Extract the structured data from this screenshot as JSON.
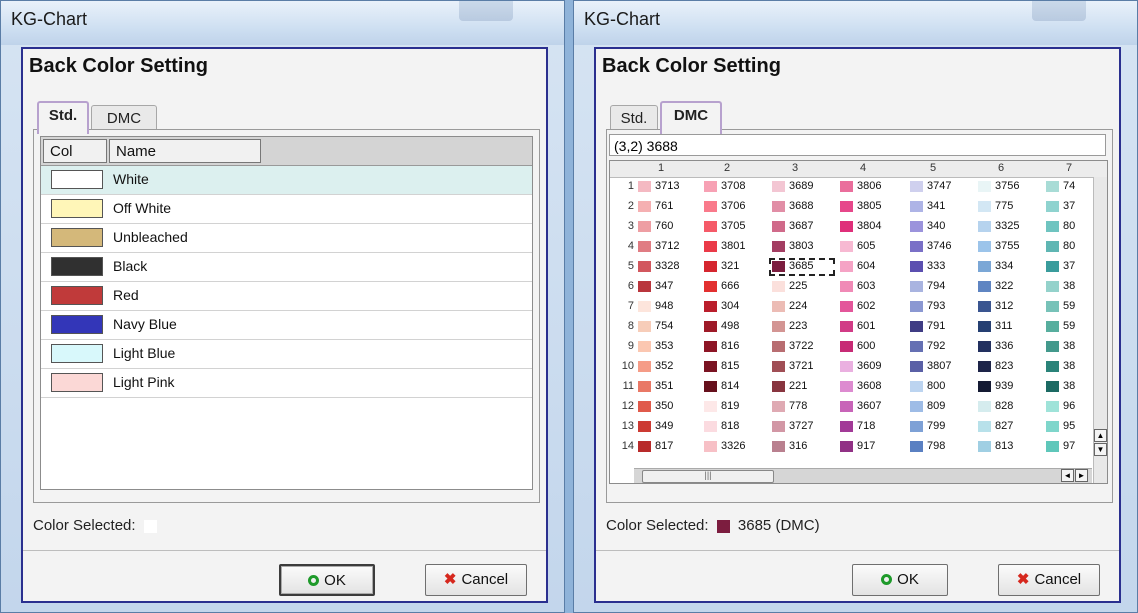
{
  "left": {
    "window_title": "KG-Chart",
    "header": "Back Color Setting",
    "tabs": [
      {
        "label": "Std.",
        "active": true
      },
      {
        "label": "DMC",
        "active": false
      }
    ],
    "columns": {
      "col": "Col",
      "name": "Name"
    },
    "rows": [
      {
        "name": "White",
        "color": "#ffffff"
      },
      {
        "name": "Off White",
        "color": "#fff6b8"
      },
      {
        "name": "Unbleached",
        "color": "#d4b87a"
      },
      {
        "name": "Black",
        "color": "#303030"
      },
      {
        "name": "Red",
        "color": "#c03a3a"
      },
      {
        "name": "Navy Blue",
        "color": "#3336b8"
      },
      {
        "name": "Light Blue",
        "color": "#d8f8fb"
      },
      {
        "name": "Light Pink",
        "color": "#fbd8d6"
      }
    ],
    "color_selected_label": "Color Selected:",
    "ok_label": "OK",
    "cancel_label": "Cancel"
  },
  "right": {
    "window_title": "KG-Chart",
    "header": "Back Color Setting",
    "tabs": [
      {
        "label": "Std.",
        "active": false
      },
      {
        "label": "DMC",
        "active": true
      }
    ],
    "address": "(3,2) 3688",
    "col_headers": [
      "1",
      "2",
      "3",
      "4",
      "5",
      "6",
      "7"
    ],
    "row_numbers": [
      "1",
      "2",
      "3",
      "4",
      "5",
      "6",
      "7",
      "8",
      "9",
      "10",
      "11",
      "12",
      "13",
      "14"
    ],
    "cells": [
      [
        [
          "3713",
          "#f4b9c2"
        ],
        [
          "3708",
          "#f7a1b4"
        ],
        [
          "3689",
          "#f3c6d3"
        ],
        [
          "3806",
          "#ea6e9c"
        ],
        [
          "3747",
          "#cfd0ee"
        ],
        [
          "3756",
          "#e9f5f6"
        ],
        [
          "74",
          "#a8dcd6"
        ]
      ],
      [
        [
          "761",
          "#f5b0b2"
        ],
        [
          "3706",
          "#f97a8b"
        ],
        [
          "3688",
          "#e18ea6"
        ],
        [
          "3805",
          "#e6478a"
        ],
        [
          "341",
          "#aeb4e6"
        ],
        [
          "775",
          "#d3e7f4"
        ],
        [
          "37",
          "#8fd3cf"
        ]
      ],
      [
        [
          "760",
          "#ee9ea3"
        ],
        [
          "3705",
          "#f55a68"
        ],
        [
          "3687",
          "#d06a8a"
        ],
        [
          "3804",
          "#df2f7a"
        ],
        [
          "340",
          "#9b93dc"
        ],
        [
          "3325",
          "#b6d3ee"
        ],
        [
          "80",
          "#6fc4c0"
        ]
      ],
      [
        [
          "3712",
          "#e07c83"
        ],
        [
          "3801",
          "#ea3a48"
        ],
        [
          "3803",
          "#a33d62"
        ],
        [
          "605",
          "#f7b9d2"
        ],
        [
          "3746",
          "#7a70c7"
        ],
        [
          "3755",
          "#9cc4ea"
        ],
        [
          "80",
          "#5fb6b3"
        ]
      ],
      [
        [
          "3328",
          "#d2575e"
        ],
        [
          "321",
          "#d5262f"
        ],
        [
          "3685",
          "#7c1d3f"
        ],
        [
          "604",
          "#f5a3c5"
        ],
        [
          "333",
          "#5b4fb0"
        ],
        [
          "334",
          "#7ba7d6"
        ],
        [
          "37",
          "#3a9c9c"
        ]
      ],
      [
        [
          "347",
          "#b9353c"
        ],
        [
          "666",
          "#e23030"
        ],
        [
          "225",
          "#fbe0dc"
        ],
        [
          "603",
          "#f08ab6"
        ],
        [
          "794",
          "#a9b4e0"
        ],
        [
          "322",
          "#5f85c2"
        ],
        [
          "38",
          "#94d2cb"
        ]
      ],
      [
        [
          "948",
          "#fde5dc"
        ],
        [
          "304",
          "#ba1e2c"
        ],
        [
          "224",
          "#ecbcb5"
        ],
        [
          "602",
          "#e3569a"
        ],
        [
          "793",
          "#8b98d2"
        ],
        [
          "312",
          "#3a5590"
        ],
        [
          "59",
          "#77c2b8"
        ]
      ],
      [
        [
          "754",
          "#f7cdb9"
        ],
        [
          "498",
          "#9e1a28"
        ],
        [
          "223",
          "#d39593"
        ],
        [
          "601",
          "#d13b86"
        ],
        [
          "791",
          "#3f3c84"
        ],
        [
          "311",
          "#253f72"
        ],
        [
          "59",
          "#57ae9e"
        ]
      ],
      [
        [
          "353",
          "#fbc7b1"
        ],
        [
          "816",
          "#8d1525"
        ],
        [
          "3722",
          "#b86d71"
        ],
        [
          "600",
          "#c72b75"
        ],
        [
          "792",
          "#6570b3"
        ],
        [
          "336",
          "#22305f"
        ],
        [
          "38",
          "#43998c"
        ]
      ],
      [
        [
          "352",
          "#f59c87"
        ],
        [
          "815",
          "#7a1322"
        ],
        [
          "3721",
          "#a04e55"
        ],
        [
          "3609",
          "#eab0e0"
        ],
        [
          "3807",
          "#5a60a6"
        ],
        [
          "823",
          "#1d2448"
        ],
        [
          "38",
          "#2a8379"
        ]
      ],
      [
        [
          "351",
          "#e97866"
        ],
        [
          "814",
          "#66101c"
        ],
        [
          "221",
          "#88353f"
        ],
        [
          "3608",
          "#dd8bd0"
        ],
        [
          "800",
          "#bcd4f0"
        ],
        [
          "939",
          "#141a33"
        ],
        [
          "38",
          "#1c6a63"
        ]
      ],
      [
        [
          "350",
          "#e05a4b"
        ],
        [
          "819",
          "#fde8e8"
        ],
        [
          "778",
          "#dfaab3"
        ],
        [
          "3607",
          "#c864b8"
        ],
        [
          "809",
          "#9ebce6"
        ],
        [
          "828",
          "#d5ecee"
        ],
        [
          "96",
          "#9fe3d9"
        ]
      ],
      [
        [
          "349",
          "#cc3a33"
        ],
        [
          "818",
          "#fbdbe0"
        ],
        [
          "3727",
          "#d297a5"
        ],
        [
          "718",
          "#a23a97"
        ],
        [
          "799",
          "#7ea1d6"
        ],
        [
          "827",
          "#b8e1ea"
        ],
        [
          "95",
          "#7fd6cb"
        ]
      ],
      [
        [
          "817",
          "#b82a2a"
        ],
        [
          "3326",
          "#f7c0c6"
        ],
        [
          "316",
          "#b9808f"
        ],
        [
          "917",
          "#913185"
        ],
        [
          "798",
          "#5a80c2"
        ],
        [
          "813",
          "#a0cfe3"
        ],
        [
          "97",
          "#5fc7ba"
        ]
      ]
    ],
    "color_selected_label": "Color Selected:",
    "color_selected_value": "3685 (DMC)",
    "color_selected_swatch": "#7c1d3f",
    "ok_label": "OK",
    "cancel_label": "Cancel"
  }
}
